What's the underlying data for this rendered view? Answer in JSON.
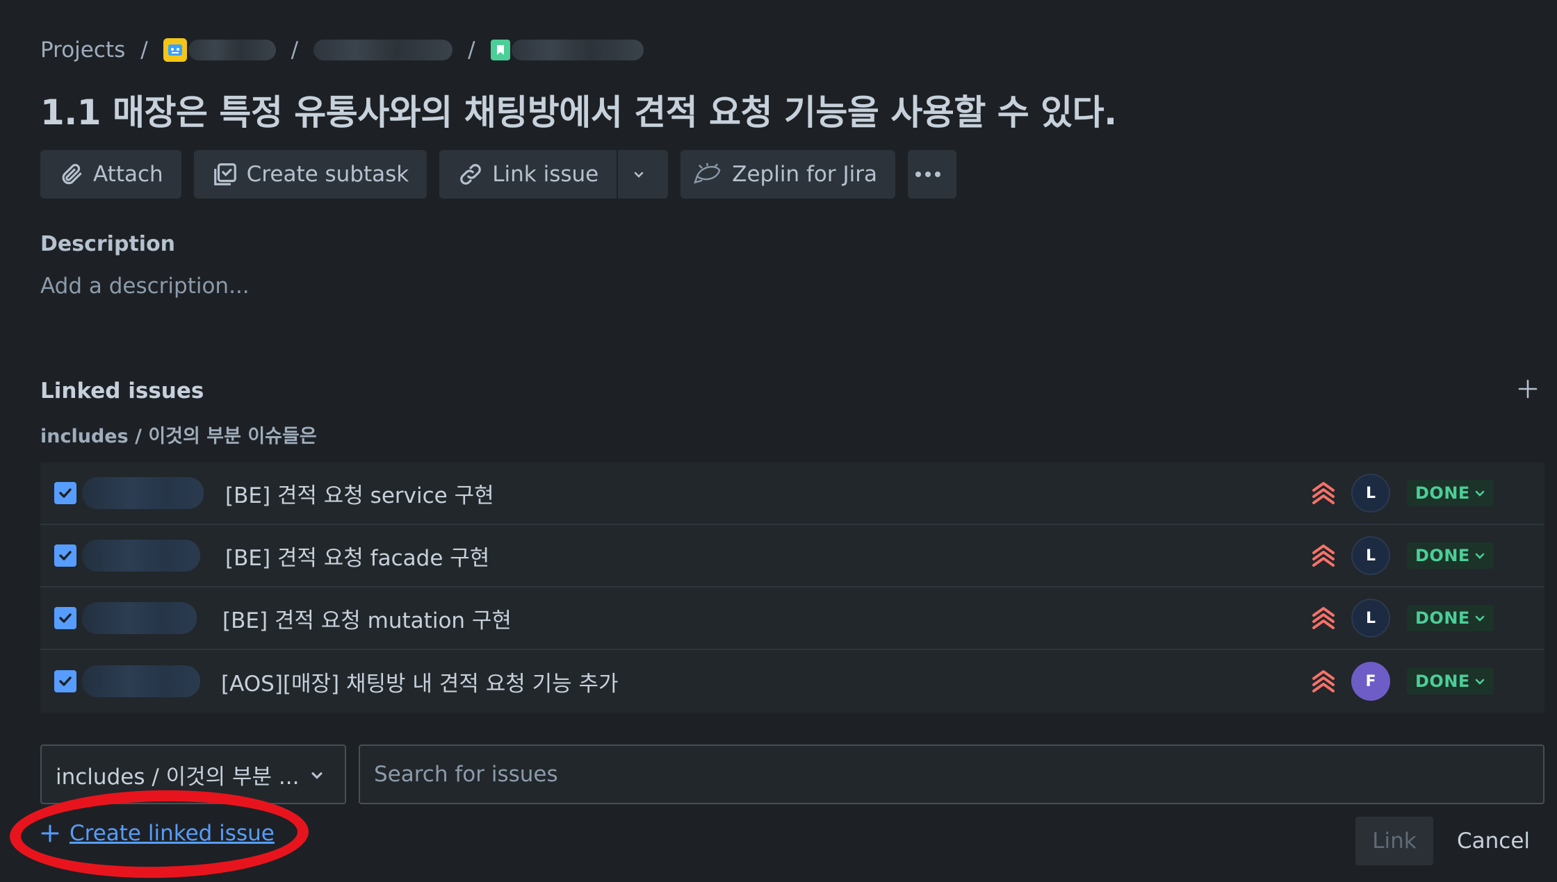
{
  "breadcrumb": {
    "projects": "Projects",
    "separator": "/"
  },
  "issue": {
    "title": "1.1 매장은 특정 유통사와의 채팅방에서 견적 요청 기능을 사용할 수 있다."
  },
  "toolbar": {
    "attach": "Attach",
    "create_subtask": "Create subtask",
    "link_issue": "Link issue",
    "zeplin": "Zeplin for Jira"
  },
  "description": {
    "heading": "Description",
    "placeholder": "Add a description..."
  },
  "linked_issues": {
    "heading": "Linked issues",
    "link_type": "includes / 이것의 부분 이슈들은",
    "items": [
      {
        "summary": "[BE] 견적 요청 service 구현",
        "avatar": "L",
        "status": "DONE",
        "checked": true
      },
      {
        "summary": "[BE] 견적 요청 facade 구현",
        "avatar": "L",
        "status": "DONE",
        "checked": true
      },
      {
        "summary": "[BE] 견적 요청 mutation 구현",
        "avatar": "L",
        "status": "DONE",
        "checked": true
      },
      {
        "summary": "[AOS][매장] 채팅방 내 견적 요청 기능 추가",
        "avatar": "F",
        "status": "DONE",
        "checked": true
      }
    ]
  },
  "link_form": {
    "type_selected": "includes / 이것의 부분 ...",
    "search_placeholder": "Search for issues",
    "create_linked": "Create linked issue",
    "link_button": "Link",
    "cancel_button": "Cancel"
  },
  "colors": {
    "background": "#1d2125",
    "accent_link": "#579dff",
    "status_done": "#4bce97",
    "priority": "#f87168",
    "highlight": "#e8141d"
  },
  "icons": {
    "attach": "paperclip-icon",
    "subtask": "subtask-icon",
    "link": "link-icon",
    "zeplin": "zeplin-icon",
    "more": "ellipsis-icon",
    "priority": "highest-priority-icon"
  }
}
